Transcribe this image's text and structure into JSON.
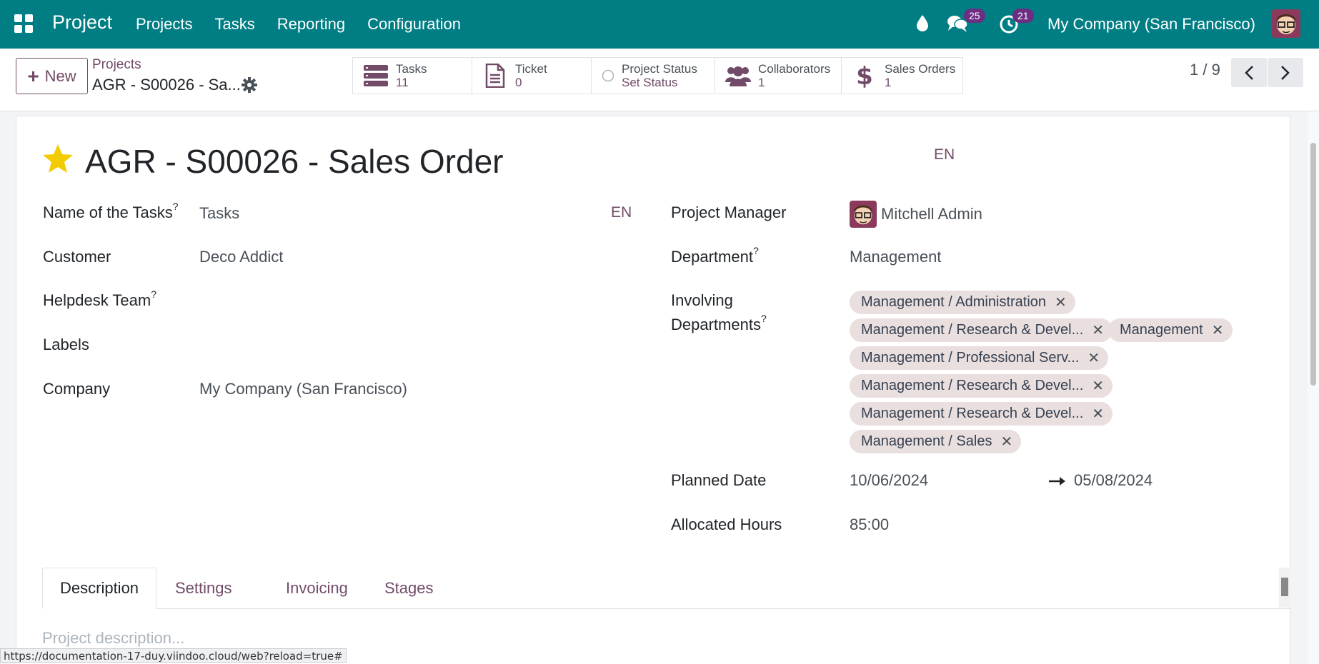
{
  "navbar": {
    "app_name": "Project",
    "menu": [
      "Projects",
      "Tasks",
      "Reporting",
      "Configuration"
    ],
    "messages_count": "25",
    "activities_count": "21",
    "company": "My Company (San Francisco)",
    "icons": [
      "apps-icon",
      "drop-icon",
      "chat-icon",
      "clock-icon",
      "avatar"
    ]
  },
  "control": {
    "new_label": "New",
    "breadcrumb_parent": "Projects",
    "breadcrumb_current": "AGR - S00026 - Sa...",
    "stats": [
      {
        "label": "Tasks",
        "value": "11"
      },
      {
        "label": "Ticket",
        "value": "0"
      },
      {
        "label": "Project Status",
        "value": "Set Status"
      },
      {
        "label": "Collaborators",
        "value": "1"
      },
      {
        "label": "Sales Orders",
        "value": "1"
      }
    ],
    "pager": "1 / 9"
  },
  "form": {
    "title": "AGR - S00026 - Sales Order",
    "title_lang": "EN",
    "left": {
      "task_name_label": "Name of the Tasks",
      "task_name_value": "Tasks",
      "task_name_lang": "EN",
      "customer_label": "Customer",
      "customer_value": "Deco Addict",
      "helpdesk_label": "Helpdesk Team",
      "labels_label": "Labels",
      "company_label": "Company",
      "company_value": "My Company (San Francisco)"
    },
    "right": {
      "manager_label": "Project Manager",
      "manager_value": "Mitchell Admin",
      "department_label": "Department",
      "department_value": "Management",
      "involving_label_1": "Involving",
      "involving_label_2": "Departments",
      "involving_tags": [
        "Management / Administration",
        "Management / Research & Devel...",
        "Management",
        "Management / Professional Serv...",
        "Management / Research & Devel...",
        "Management / Research & Devel...",
        "Management / Sales"
      ],
      "planned_label": "Planned Date",
      "planned_start": "10/06/2024",
      "planned_end": "05/08/2024",
      "hours_label": "Allocated Hours",
      "hours_value": "85:00"
    },
    "help_mark": "?",
    "tabs": [
      "Description",
      "Settings",
      "Invoicing",
      "Stages"
    ],
    "description_placeholder": "Project description..."
  },
  "status_url": "https://documentation-17-duy.viindoo.cloud/web?reload=true#",
  "colors": {
    "navbar": "#017e84",
    "brand": "#714b67",
    "badge": "#6c2d82",
    "star": "#f3cc00",
    "tag": "#e9dfdf"
  }
}
